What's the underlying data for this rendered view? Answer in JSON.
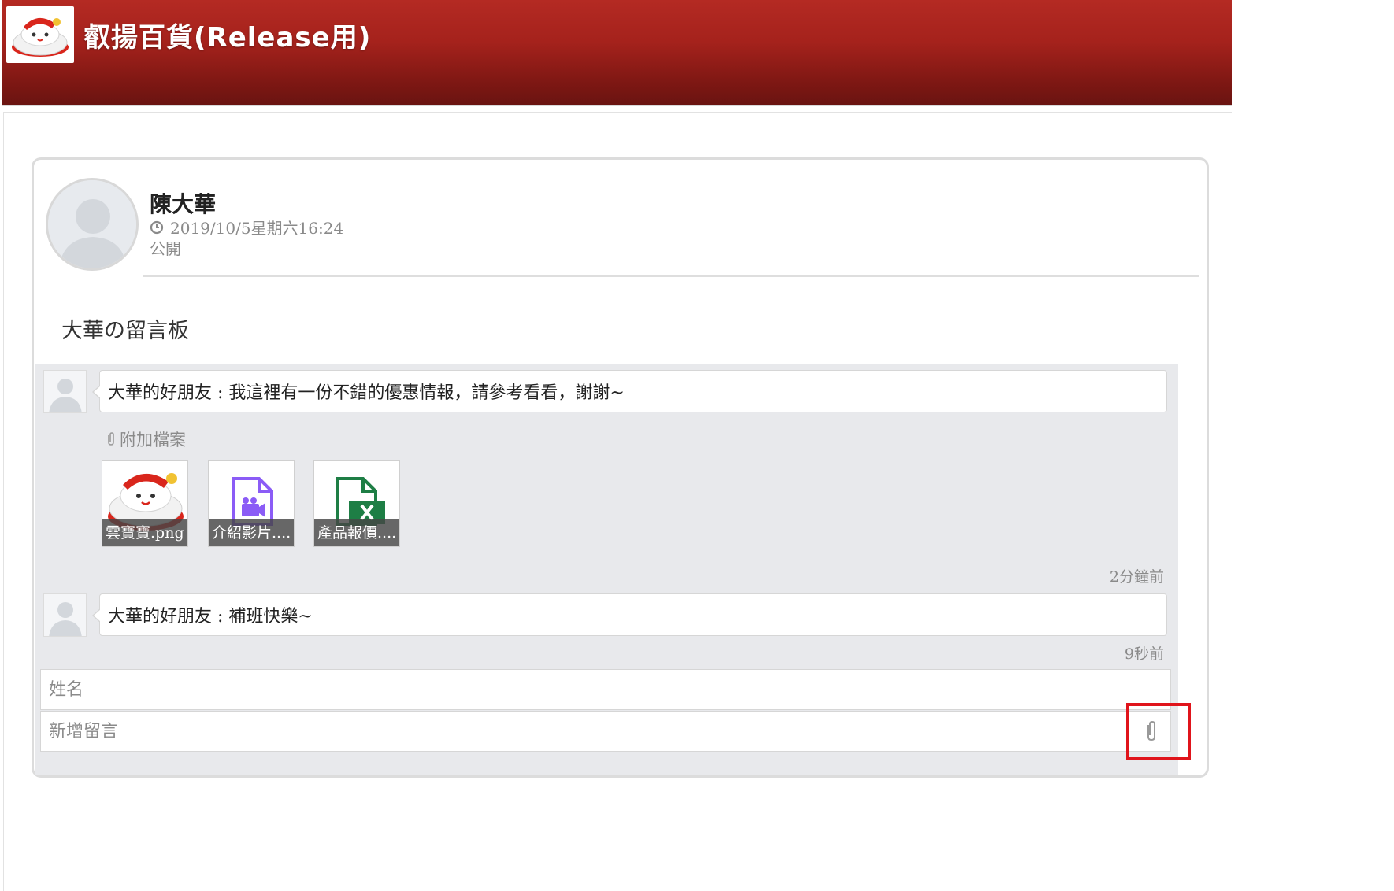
{
  "app": {
    "title": "叡揚百貨(Release用)"
  },
  "post": {
    "author": "陳大華",
    "timestamp": "2019/10/5星期六16:24",
    "visibility": "公開",
    "body": "大華の留言板"
  },
  "comments": [
    {
      "text": "大華的好朋友 : 我這裡有一份不錯的優惠情報，請參考看看，謝謝~",
      "attachments_label": "附加檔案",
      "attachments": [
        {
          "name": "雲寶寶.png",
          "icon": "image-thumbnail"
        },
        {
          "name": "介紹影片....",
          "icon": "video-file-icon",
          "color": "#8b5cf6"
        },
        {
          "name": "產品報價....",
          "icon": "excel-file-icon",
          "color": "#1e7e45"
        }
      ],
      "time": "2分鐘前"
    },
    {
      "text": "大華的好朋友 : 補班快樂~",
      "time": "9秒前"
    }
  ],
  "form": {
    "name_placeholder": "姓名",
    "comment_placeholder": "新增留言",
    "attach_icon": "paperclip-icon"
  },
  "colors": {
    "header": "#a5221c",
    "highlight": "#e0141b"
  }
}
